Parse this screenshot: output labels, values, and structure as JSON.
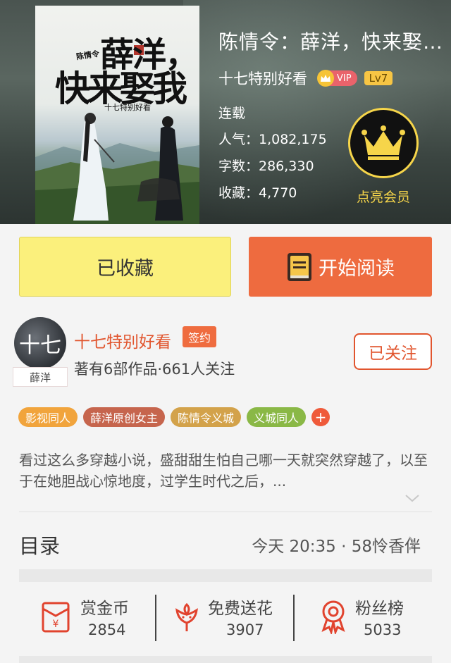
{
  "book": {
    "title": "陈情令：薛洋，快来娶…",
    "author": "十七特别好看",
    "vip_label": "VIP",
    "level": "Lv7",
    "status": "连载",
    "popularity": "人气：1,082,175",
    "word_count": "字数：286,330",
    "favorites": "收藏：4,770",
    "member_label": "点亮会员"
  },
  "cover": {
    "author_tag": "陈情令",
    "title_line1": "薛洋，",
    "title_line2": "快来娶我",
    "pen_name": "十七特别好看"
  },
  "actions": {
    "favorite_label": "已收藏",
    "read_label": "开始阅读"
  },
  "author_card": {
    "avatar_text": "十七",
    "avatar_tag": "薛洋",
    "name": "十七特别好看",
    "sign_badge": "签约",
    "meta": "著有6部作品·661人关注",
    "follow_label": "已关注"
  },
  "tags": [
    {
      "label": "影视同人",
      "color": "#f1a43c"
    },
    {
      "label": "薛洋原创女主",
      "color": "#c6654d"
    },
    {
      "label": "陈情令义城",
      "color": "#d3a24a"
    },
    {
      "label": "义城同人",
      "color": "#8ab846"
    }
  ],
  "tag_more": "+",
  "synopsis": "看过这么多穿越小说，盛甜甜生怕自己哪一天就突然穿越了，以至于在她胆战心惊地度，过学生时代之后，...",
  "catalog": {
    "title": "目录",
    "latest": "今天 20:35 · 58怜香伴"
  },
  "bottom_stats": [
    {
      "label": "赏金币",
      "value": "2854",
      "icon": "red-envelope-icon"
    },
    {
      "label": "免费送花",
      "value": "3907",
      "icon": "flower-icon"
    },
    {
      "label": "粉丝榜",
      "value": "5033",
      "icon": "medal-icon"
    }
  ],
  "colors": {
    "accent_orange": "#ee6b3f",
    "author_red": "#e1552e",
    "favorite_yellow": "#fbf07c",
    "member_gold": "#f6d54a"
  }
}
